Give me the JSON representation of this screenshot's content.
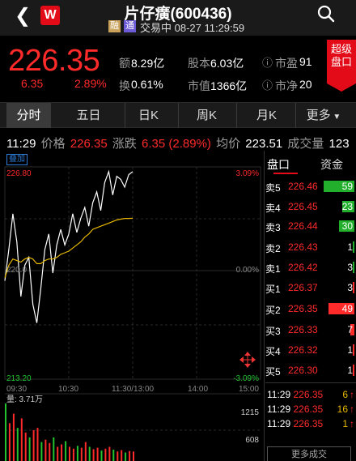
{
  "header": {
    "back_icon": "chevron-left-icon",
    "logo_text": "W",
    "title": "片仔癀(600436)",
    "tag_rong": "融",
    "tag_tong": "通",
    "status": "交易中 08-27 11:29:59",
    "search_icon": "search-icon"
  },
  "quote": {
    "price": "226.35",
    "change": "6.35",
    "change_pct": "2.89%",
    "amount_label": "额",
    "amount_value": "8.29亿",
    "share_label": "股本",
    "share_value": "6.03亿",
    "pe_label": "市盈",
    "pe_value": "91",
    "turnover_label": "换",
    "turnover_value": "0.61%",
    "mcap_label": "市值",
    "mcap_value": "1366亿",
    "pb_label": "市净",
    "pb_value": "20",
    "super_label_1": "超级",
    "super_label_2": "盘口"
  },
  "tabs": [
    "分时",
    "五日",
    "日K",
    "周K",
    "月K",
    "更多"
  ],
  "info_line": {
    "time": "11:29",
    "price_label": "价格",
    "price": "226.35",
    "change_label": "涨跌",
    "change": "6.35 (2.89%)",
    "avg_label": "均价",
    "avg": "223.51",
    "vol_label": "成交量",
    "vol": "123"
  },
  "chart": {
    "overlay_label": "叠加",
    "y_top": "226.80",
    "y_mid": "220.0",
    "y_bottom": "213.20",
    "pct_top": "3.09%",
    "pct_mid": "0.00%",
    "pct_bottom": "-3.09%",
    "x_labels": [
      "09:30",
      "10:30",
      "11:30/13:00",
      "14:00",
      "15:00"
    ],
    "volume_label": "量: 3.71万",
    "vol_tick_1": "1215",
    "vol_tick_2": "608"
  },
  "chart_data": {
    "type": "line",
    "ylim": [
      213.2,
      226.8
    ],
    "series": [
      {
        "values": [
          219.5,
          221.5,
          223.8,
          222.0,
          218.5,
          220.5,
          221.0,
          218.0,
          216.8,
          219.0,
          221.5,
          222.5,
          220.0,
          221.8,
          222.8,
          221.8,
          222.5,
          223.8,
          222.6,
          223.5,
          224.2,
          223.0,
          224.5,
          225.2,
          224.0,
          225.8,
          226.5,
          225.0,
          226.2,
          226.0,
          225.5,
          226.3,
          226.5
        ]
      },
      {
        "values": [
          219.7,
          220.5,
          220.9,
          220.8,
          220.7,
          220.9,
          221.0,
          220.9,
          220.6,
          220.6,
          220.8,
          220.9,
          220.9,
          221.0,
          221.2,
          221.3,
          221.4,
          221.6,
          221.8,
          222.0,
          222.3,
          222.5,
          222.8,
          222.9,
          223.0,
          223.1,
          223.2,
          223.3,
          223.4,
          223.45,
          223.5,
          223.5,
          223.51
        ]
      }
    ],
    "volume": [
      1215,
      800,
      1000,
      700,
      900,
      600,
      500,
      650,
      700,
      400,
      450,
      380,
      500,
      300,
      350,
      420,
      300,
      260,
      320,
      280,
      400,
      300,
      250,
      280,
      220,
      260,
      300,
      240,
      200,
      230,
      180,
      210,
      200
    ]
  },
  "orderbook": {
    "tab_pankou": "盘口",
    "tab_zijin": "资金",
    "rows": [
      {
        "label": "卖5",
        "price": "226.46",
        "vol": "59",
        "bar_color": "#22b02c",
        "bar_frac": 1.0
      },
      {
        "label": "卖4",
        "price": "226.45",
        "vol": "23",
        "bar_color": "#22b02c",
        "bar_frac": 0.39
      },
      {
        "label": "卖3",
        "price": "226.44",
        "vol": "30",
        "bar_color": "#22b02c",
        "bar_frac": 0.51
      },
      {
        "label": "卖2",
        "price": "226.43",
        "vol": "1",
        "bar_color": "#22b02c",
        "bar_frac": 0.04
      },
      {
        "label": "卖1",
        "price": "226.42",
        "vol": "3",
        "bar_color": "#22b02c",
        "bar_frac": 0.06
      },
      {
        "label": "买1",
        "price": "226.37",
        "vol": "3",
        "bar_color": "#ff2a2a",
        "bar_frac": 0.06
      },
      {
        "label": "买2",
        "price": "226.35",
        "vol": "49",
        "bar_color": "#ff2a2a",
        "bar_frac": 0.83
      },
      {
        "label": "买3",
        "price": "226.33",
        "vol": "7",
        "bar_color": "#ff2a2a",
        "bar_frac": 0.12
      },
      {
        "label": "买4",
        "price": "226.32",
        "vol": "1",
        "bar_color": "#ff2a2a",
        "bar_frac": 0.04
      },
      {
        "label": "买5",
        "price": "226.30",
        "vol": "1",
        "bar_color": "#ff2a2a",
        "bar_frac": 0.04
      }
    ],
    "trades": [
      {
        "time": "11:29",
        "price": "226.35",
        "vol": "6",
        "dir": "up"
      },
      {
        "time": "11:29",
        "price": "226.35",
        "vol": "16",
        "dir": "up"
      },
      {
        "time": "11:29",
        "price": "226.35",
        "vol": "1",
        "dir": "up"
      }
    ],
    "more_label": "更多成交"
  }
}
